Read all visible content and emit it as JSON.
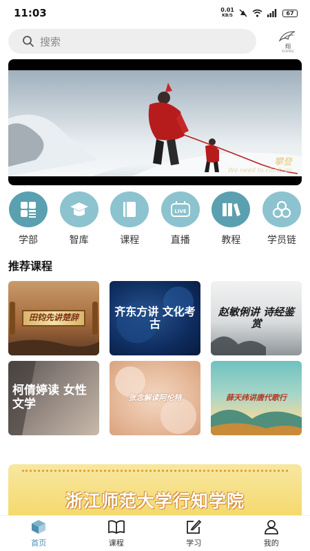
{
  "status_bar": {
    "time": "11:03",
    "net_speed": "0.01",
    "net_unit": "KB/S",
    "battery": "67"
  },
  "search": {
    "placeholder": "搜索"
  },
  "logo": {
    "text": "翔",
    "sub": "XIANG"
  },
  "banner": {
    "caption_main": "攀登",
    "caption_sub": "We need to climb on"
  },
  "categories": [
    {
      "label": "学部",
      "icon": "grid-icon",
      "color": "#5ba0b0"
    },
    {
      "label": "智库",
      "icon": "graduation-cap-icon",
      "color": "#8cc3cf"
    },
    {
      "label": "课程",
      "icon": "book-icon",
      "color": "#8cc3cf"
    },
    {
      "label": "直播",
      "icon": "live-tv-icon",
      "color": "#8cc3cf"
    },
    {
      "label": "教程",
      "icon": "books-icon",
      "color": "#5ba0b0"
    },
    {
      "label": "学员链",
      "icon": "link-icon",
      "color": "#8cc3cf"
    }
  ],
  "section": {
    "recommended_title": "推荐课程"
  },
  "courses": [
    {
      "title": "田钧先讲楚辞"
    },
    {
      "title": "齐东方讲 文化考古"
    },
    {
      "title": "赵敏俐讲 诗经鉴赏"
    },
    {
      "title": "柯倩婷读 女性文学"
    },
    {
      "title": "张念解读阿伦特"
    },
    {
      "title": "薛天纬讲唐代歌行"
    }
  ],
  "promo": {
    "title": "浙江师范大学行知学院"
  },
  "tabbar": {
    "items": [
      {
        "label": "首页",
        "icon": "home-cube-icon",
        "active": true
      },
      {
        "label": "课程",
        "icon": "open-book-icon",
        "active": false
      },
      {
        "label": "学习",
        "icon": "edit-icon",
        "active": false
      },
      {
        "label": "我的",
        "icon": "user-icon",
        "active": false
      }
    ]
  },
  "colors": {
    "accent": "#4e8fb0",
    "icon_dark": "#5ba0b0",
    "icon_light": "#8cc3cf"
  }
}
